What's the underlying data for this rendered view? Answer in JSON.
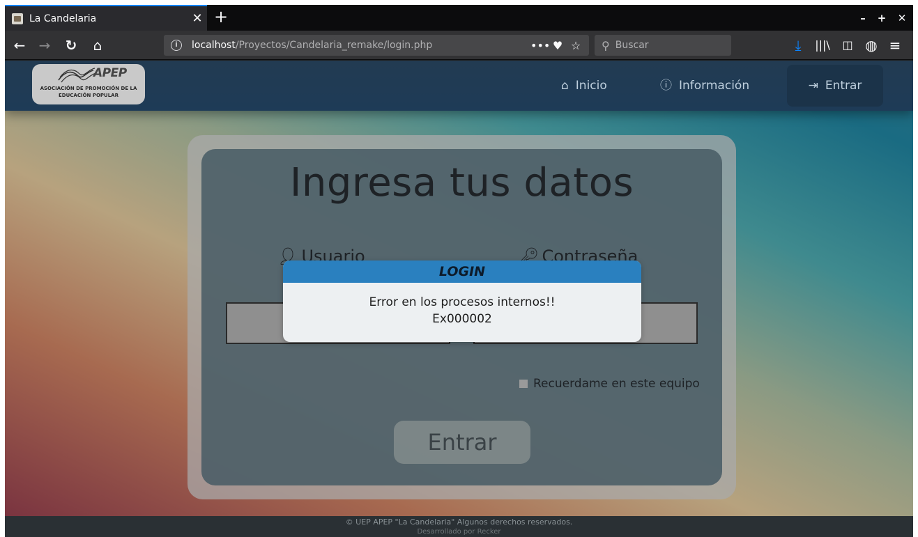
{
  "browser": {
    "tab_title": "La Candelaria",
    "url_host": "localhost",
    "url_path": "/Proyectos/Candelaria_remake/login.php",
    "search_placeholder": "Buscar"
  },
  "site": {
    "logo_text": "APEP",
    "logo_subtitle": "ASOCIACIÓN DE PROMOCIÓN DE LA EDUCACIÓN POPULAR",
    "nav": {
      "inicio": "Inicio",
      "informacion": "Información",
      "entrar": "Entrar"
    }
  },
  "login": {
    "title": "Ingresa tus datos",
    "usuario_label": "Usuario",
    "password_label": "Contraseña",
    "remember_label": "Recuerdame en este equipo",
    "submit_label": "Entrar"
  },
  "modal": {
    "title": "LOGIN",
    "message": "Error en los procesos internos!!",
    "code": "Ex000002"
  },
  "footer": {
    "line1": "© UEP APEP \"La Candelaria\" Algunos derechos reservados.",
    "line2": "Desarrollado por Recker"
  },
  "colors": {
    "modal_header": "#2a80bf",
    "site_header": "#1e3b57",
    "accent_download": "#0a84ff"
  }
}
